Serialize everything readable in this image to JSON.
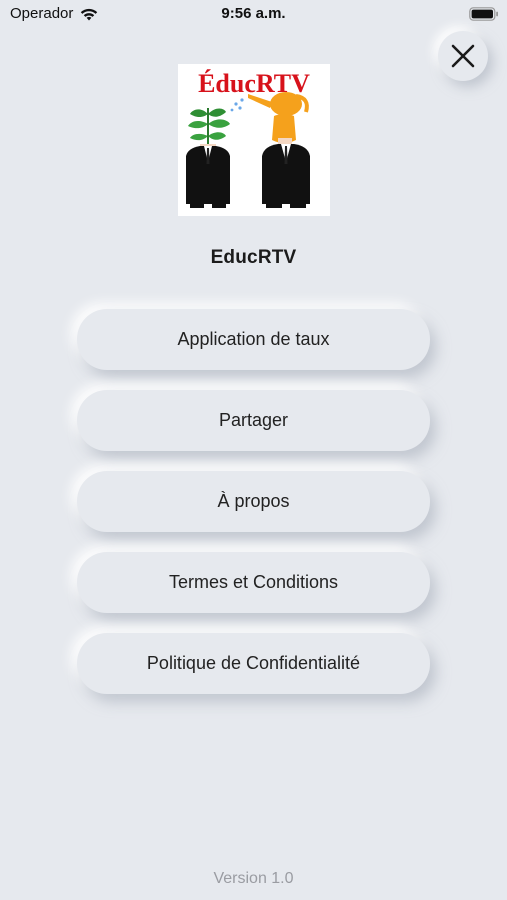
{
  "status_bar": {
    "carrier": "Operador",
    "time": "9:56 a.m.",
    "wifi_icon": "wifi-icon",
    "battery_icon": "battery-icon"
  },
  "close_button": {
    "icon": "close-icon"
  },
  "logo": {
    "text": "ÉducRTV",
    "text_color": "#d7121b",
    "description_icon": "logo-image"
  },
  "app_name": "EducRTV",
  "menu": {
    "items": [
      {
        "label": "Application de taux"
      },
      {
        "label": "Partager"
      },
      {
        "label": "À propos"
      },
      {
        "label": "Termes et Conditions"
      },
      {
        "label": "Politique de Confidentialité"
      }
    ]
  },
  "footer": {
    "version": "Version 1.0"
  },
  "colors": {
    "background": "#e6e9ee",
    "button_text": "#222222",
    "version_text": "#9a9ca2"
  }
}
